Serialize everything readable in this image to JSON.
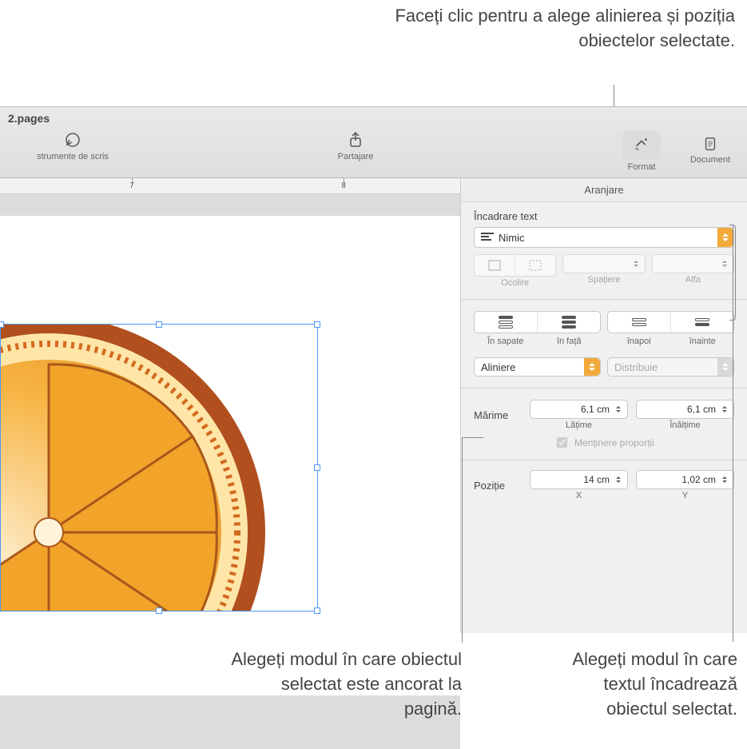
{
  "annotations": {
    "top": "Faceți clic pentru a alege alinierea și poziția obiectelor selectate.",
    "bottom_left": "Alegeți modul în care obiectul selectat este ancorat la pagină.",
    "bottom_right": "Alegeți modul în care textul încadrează obiectul selectat."
  },
  "window": {
    "title": "2.pages"
  },
  "toolbar": {
    "tools_label": "strumente de scris",
    "share_label": "Partajare",
    "format_label": "Format",
    "document_label": "Document"
  },
  "ruler": {
    "ticks": [
      "7",
      "8"
    ]
  },
  "inspector": {
    "tab": "Aranjare",
    "wrap_section_label": "Încadrare text",
    "wrap_value": "Nimic",
    "wrap_sublabels": {
      "fit": "Ocolire",
      "spacing": "Spațiere",
      "alpha": "Alfa"
    },
    "layer": {
      "back": "În sapate",
      "front": "în față",
      "backward": "înapoi",
      "forward": "înainte"
    },
    "align_label": "Aliniere",
    "distribute_label": "Distribuie",
    "size_label": "Mărime",
    "width_value": "6,1 cm",
    "width_label": "Lățime",
    "height_value": "6,1 cm",
    "height_label": "Înălțime",
    "constrain_label": "Menținere proporții",
    "position_label": "Poziție",
    "x_value": "14 cm",
    "x_label": "X",
    "y_value": "1,02 cm",
    "y_label": "Y"
  }
}
